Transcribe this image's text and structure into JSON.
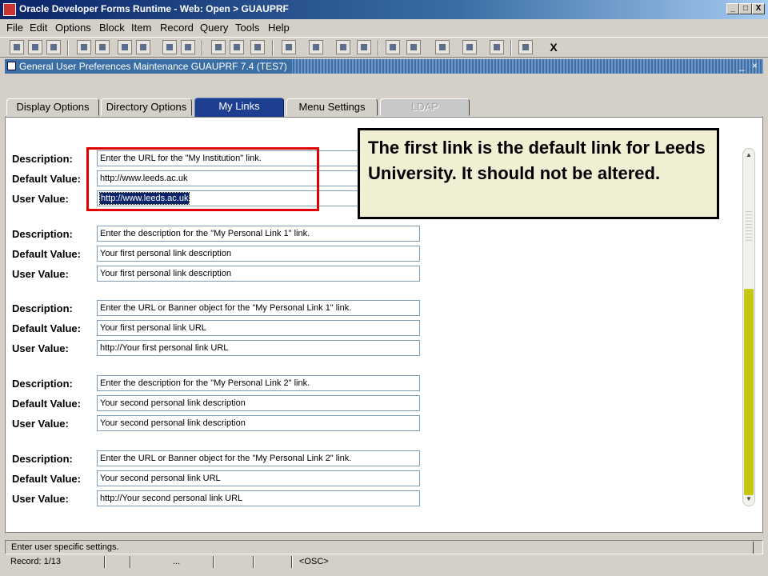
{
  "window": {
    "title": "Oracle Developer Forms Runtime - Web:  Open > GUAUPRF",
    "btn_min": "_",
    "btn_max": "□",
    "btn_close": "X"
  },
  "menu": [
    "File",
    "Edit",
    "Options",
    "Block",
    "Item",
    "Record",
    "Query",
    "Tools",
    "Help"
  ],
  "toolbar": {
    "exit_label": "X"
  },
  "form": {
    "title": "General User Preferences Maintenance  GUAUPRF  7.4  (TES7)",
    "ctl_min": "_",
    "ctl_close": "×"
  },
  "tabs": [
    "Display Options",
    "Directory Options",
    "My Links",
    "Menu Settings",
    "LDAP"
  ],
  "labels": {
    "description": "Description:",
    "default_value": "Default Value:",
    "user_value": "User Value:"
  },
  "links": [
    {
      "description": "Enter the URL for the \"My Institution\" link.",
      "default_value": "http://www.leeds.ac.uk",
      "user_value": "http://www.leeds.ac.uk"
    },
    {
      "description": "Enter the description for the \"My Personal Link 1\" link.",
      "default_value": "Your first personal link description",
      "user_value": "Your first personal link description"
    },
    {
      "description": "Enter the URL or Banner object for the \"My Personal Link 1\" link.",
      "default_value": "Your first personal link URL",
      "user_value": "http://Your first personal link URL"
    },
    {
      "description": "Enter the description for the \"My Personal Link 2\" link.",
      "default_value": "Your second personal link description",
      "user_value": "Your second personal link description"
    },
    {
      "description": "Enter the URL or Banner object for the \"My Personal Link 2\" link.",
      "default_value": "Your second personal link URL",
      "user_value": "http://Your second personal link URL"
    }
  ],
  "callout": "The first link is the default link for Leeds University. It should not be altered.",
  "status": {
    "message": "Enter user specific settings.",
    "record": "Record: 1/13",
    "ellipsis": "...",
    "osc": "<OSC>"
  },
  "colors": {
    "tab_active": "#1e3f8f",
    "highlight_box": "#e00000",
    "callout_bg": "#f0efd4",
    "scroll_thumb": "#c6c614"
  }
}
